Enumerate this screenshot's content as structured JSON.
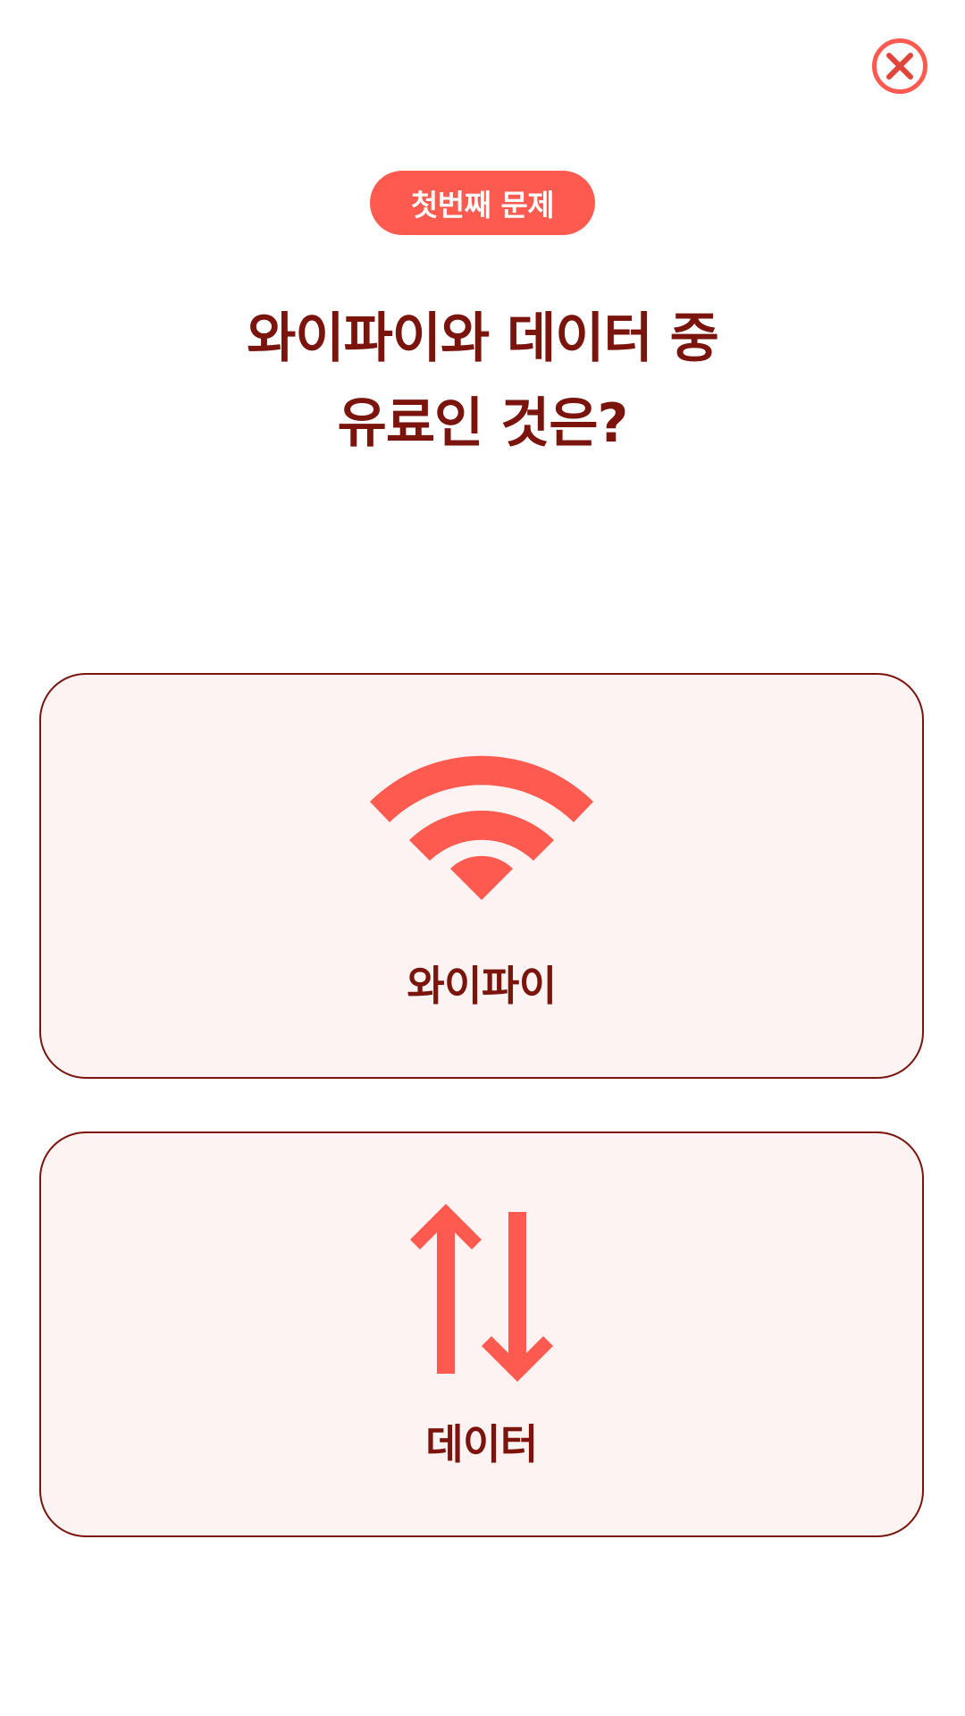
{
  "header": {
    "close_icon": "close-circle-icon",
    "accent_color": "#ff5a4f",
    "text_color": "#7a140c"
  },
  "badge": {
    "label": "첫번째 문제"
  },
  "question": {
    "line1": "와이파이와 데이터 중",
    "line2": "유료인 것은?"
  },
  "options": [
    {
      "label": "와이파이",
      "icon": "wifi-icon"
    },
    {
      "label": "데이터",
      "icon": "data-transfer-icon"
    }
  ]
}
